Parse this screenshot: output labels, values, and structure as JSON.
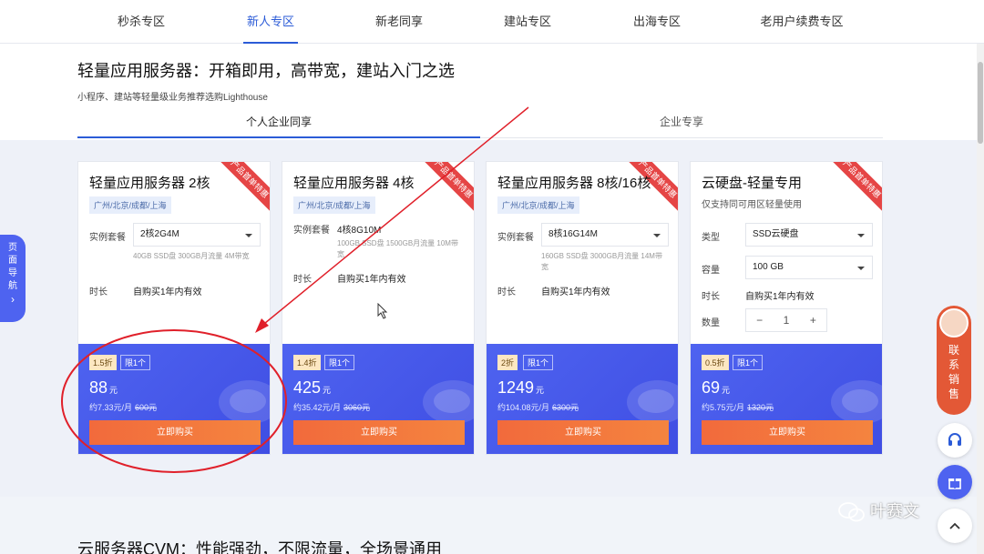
{
  "nav": {
    "items": [
      "秒杀专区",
      "新人专区",
      "新老同享",
      "建站专区",
      "出海专区",
      "老用户续费专区"
    ],
    "active_index": 1
  },
  "section": {
    "title": "轻量应用服务器：开箱即用，高带宽，建站入门之选",
    "subtitle": "小程序、建站等轻量级业务推荐选购Lighthouse",
    "tabs": [
      "个人企业同享",
      "企业专享"
    ]
  },
  "labels": {
    "instance": "实例套餐",
    "duration": "时长",
    "type": "类型",
    "capacity": "容量",
    "quantity": "数量",
    "buy": "立即购买",
    "limit": "限1个",
    "ribbon": "产品首单特惠",
    "unit": "元"
  },
  "cards": [
    {
      "title": "轻量应用服务器 2核",
      "region": "广州/北京/成都/上海",
      "spec": "2核2G4M",
      "spec_note": "40GB SSD盘 300GB月流量 4M带宽",
      "duration": "自购买1年内有效",
      "discount": "1.5折",
      "price": "88",
      "monthly": "约7.33元/月",
      "original": "600元"
    },
    {
      "title": "轻量应用服务器 4核",
      "region": "广州/北京/成都/上海",
      "spec": "4核8G10M",
      "spec_note": "100GB SSD盘 1500GB月流量 10M带宽",
      "duration": "自购买1年内有效",
      "discount": "1.4折",
      "price": "425",
      "monthly": "约35.42元/月",
      "original": "3060元"
    },
    {
      "title": "轻量应用服务器 8核/16核",
      "region": "广州/北京/成都/上海",
      "spec": "8核16G14M",
      "spec_note": "160GB SSD盘 3000GB月流量 14M带宽",
      "duration": "自购买1年内有效",
      "discount": "2折",
      "price": "1249",
      "monthly": "约104.08元/月",
      "original": "6300元"
    },
    {
      "title": "云硬盘-轻量专用",
      "subtitle": "仅支持同可用区轻量使用",
      "type": "SSD云硬盘",
      "capacity": "100 GB",
      "duration": "自购买1年内有效",
      "quantity": "1",
      "discount": "0.5折",
      "price": "69",
      "monthly": "约5.75元/月",
      "original": "1320元"
    }
  ],
  "side_nav": {
    "label_chars": [
      "页",
      "面",
      "导",
      "航"
    ],
    "arrow": "›"
  },
  "contact": {
    "label_chars": [
      "联",
      "系",
      "销",
      "售"
    ]
  },
  "stepper": {
    "minus": "−",
    "plus": "+"
  },
  "next_section": {
    "title": "云服务器CVM：性能强劲，不限流量，全场景通用"
  },
  "watermark": {
    "text": "叶赛文"
  },
  "colors": {
    "accent": "#2b5bd7",
    "price_bg": "#4e63f0",
    "buy": "#f26a3c",
    "ribbon": "#e54545",
    "annotation": "#e0202a"
  }
}
